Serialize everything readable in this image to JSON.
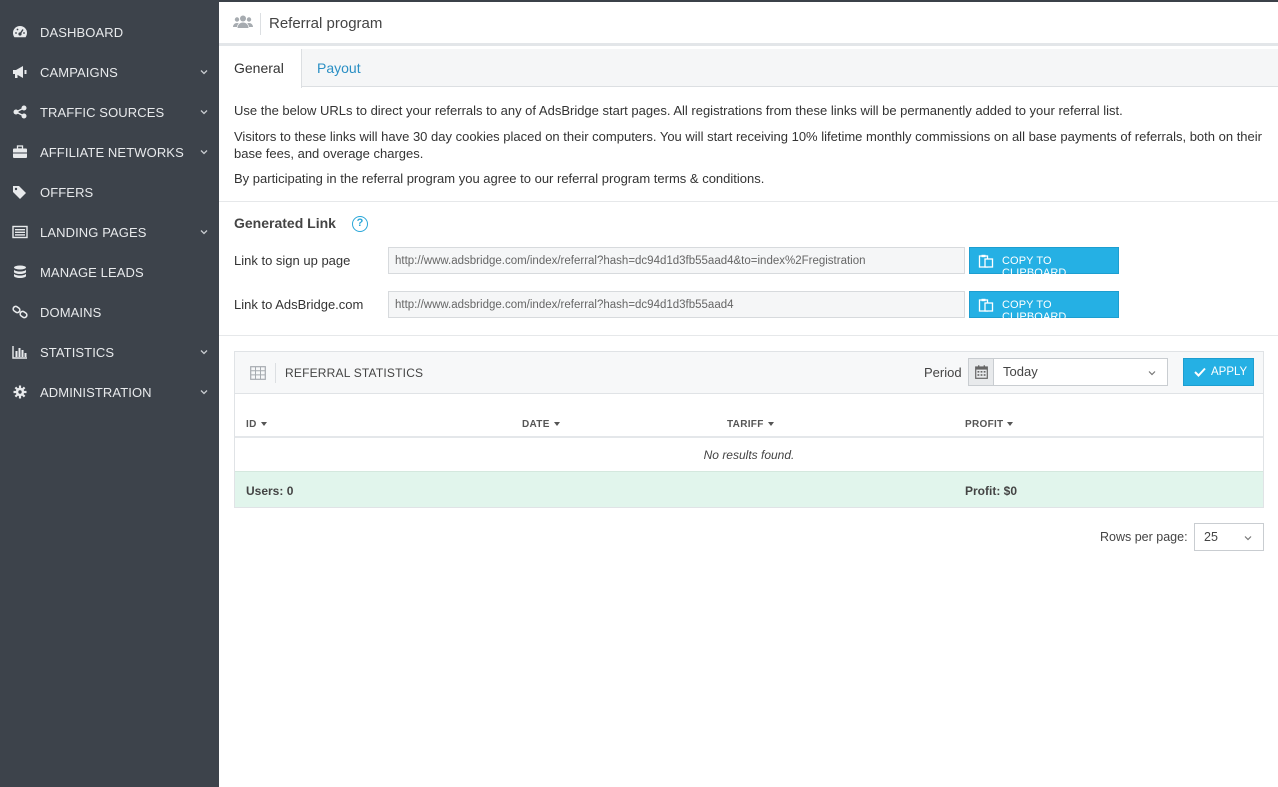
{
  "sidebar": {
    "items": [
      {
        "label": "DASHBOARD",
        "icon": "dashboard-icon",
        "expandable": false
      },
      {
        "label": "CAMPAIGNS",
        "icon": "bullhorn-icon",
        "expandable": true
      },
      {
        "label": "TRAFFIC SOURCES",
        "icon": "share-icon",
        "expandable": true
      },
      {
        "label": "AFFILIATE NETWORKS",
        "icon": "briefcase-icon",
        "expandable": true
      },
      {
        "label": "OFFERS",
        "icon": "tags-icon",
        "expandable": false
      },
      {
        "label": "LANDING PAGES",
        "icon": "list-icon",
        "expandable": true
      },
      {
        "label": "MANAGE LEADS",
        "icon": "database-icon",
        "expandable": false
      },
      {
        "label": "DOMAINS",
        "icon": "link-icon",
        "expandable": false
      },
      {
        "label": "STATISTICS",
        "icon": "bar-chart-icon",
        "expandable": true
      },
      {
        "label": "ADMINISTRATION",
        "icon": "gear-icon",
        "expandable": true
      }
    ]
  },
  "header": {
    "title": "Referral program",
    "icon": "users-icon"
  },
  "tabs": {
    "general": "General",
    "payout": "Payout"
  },
  "intro": {
    "p1": "Use the below URLs to direct your referrals to any of AdsBridge start pages. All registrations from these links will be permanently added to your referral list.",
    "p2": "Visitors to these links will have 30 day cookies placed on their computers. You will start receiving 10% lifetime monthly commissions on all base payments of referrals, both on their base fees, and overage charges.",
    "p3": "By participating in the referral program you agree to our referral program terms & conditions."
  },
  "generated": {
    "title": "Generated Link",
    "help_icon": "?",
    "links": [
      {
        "label": "Link to sign up page",
        "value": "http://www.adsbridge.com/index/referral?hash=dc94d1d3fb55aad4&to=index%2Fregistration",
        "button": "COPY TO CLIPBOARD"
      },
      {
        "label": "Link to AdsBridge.com",
        "value": "http://www.adsbridge.com/index/referral?hash=dc94d1d3fb55aad4",
        "button": "COPY TO CLIPBOARD"
      }
    ]
  },
  "stats": {
    "title": "REFERRAL STATISTICS",
    "period_label": "Period",
    "period_value": "Today",
    "apply": "APPLY",
    "columns": {
      "id": "ID",
      "date": "DATE",
      "tariff": "TARIFF",
      "profit": "PROFIT"
    },
    "empty": "No results found.",
    "footer": {
      "users": "Users: 0",
      "profit": "Profit: $0"
    }
  },
  "pagination": {
    "rows_label": "Rows per page:",
    "rows_value": "25"
  },
  "colors": {
    "sidebar_bg": "#3d434b",
    "accent": "#25b0e4",
    "link": "#2a8fc4",
    "footer_bg": "#e1f5ec"
  }
}
